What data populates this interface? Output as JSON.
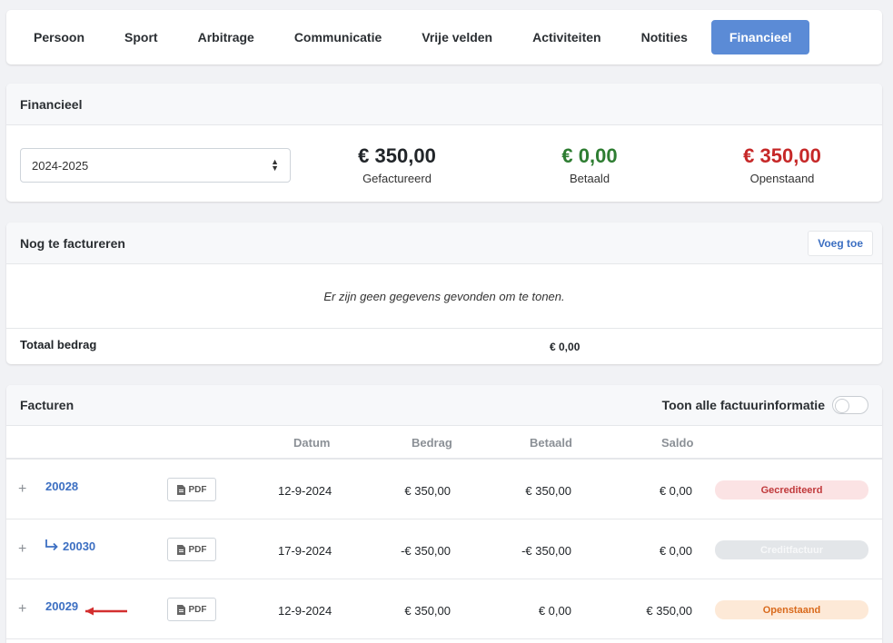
{
  "tabs": [
    "Persoon",
    "Sport",
    "Arbitrage",
    "Communicatie",
    "Vrije velden",
    "Activiteiten",
    "Notities",
    "Financieel"
  ],
  "active_tab": "Financieel",
  "financieel": {
    "title": "Financieel",
    "season": "2024-2025",
    "gefactureerd": {
      "amount": "€ 350,00",
      "label": "Gefactureerd",
      "color": "#212529"
    },
    "betaald": {
      "amount": "€ 0,00",
      "label": "Betaald",
      "color": "#2e7d32"
    },
    "openstaand": {
      "amount": "€ 350,00",
      "label": "Openstaand",
      "color": "#c62828"
    }
  },
  "nog": {
    "title": "Nog te factureren",
    "add_label": "Voeg toe",
    "empty": "Er zijn geen gegevens gevonden om te tonen.",
    "total_label": "Totaal bedrag",
    "total_value": "€ 0,00"
  },
  "facturen": {
    "title": "Facturen",
    "toggle_label": "Toon alle factuurinformatie",
    "toggle_on": false,
    "columns": {
      "datum": "Datum",
      "bedrag": "Bedrag",
      "betaald": "Betaald",
      "saldo": "Saldo"
    },
    "pdf_label": "PDF",
    "rows": [
      {
        "nr": "20028",
        "datum": "12-9-2024",
        "bedrag": "€ 350,00",
        "betaald": "€ 350,00",
        "saldo": "€ 0,00",
        "status": "Gecrediteerd"
      },
      {
        "nr": "20030",
        "datum": "17-9-2024",
        "bedrag": "-€ 350,00",
        "betaald": "-€ 350,00",
        "saldo": "€ 0,00",
        "status": "Creditfactuur"
      },
      {
        "nr": "20029",
        "datum": "12-9-2024",
        "bedrag": "€ 350,00",
        "betaald": "€ 0,00",
        "saldo": "€ 350,00",
        "status": "Openstaand"
      }
    ]
  }
}
